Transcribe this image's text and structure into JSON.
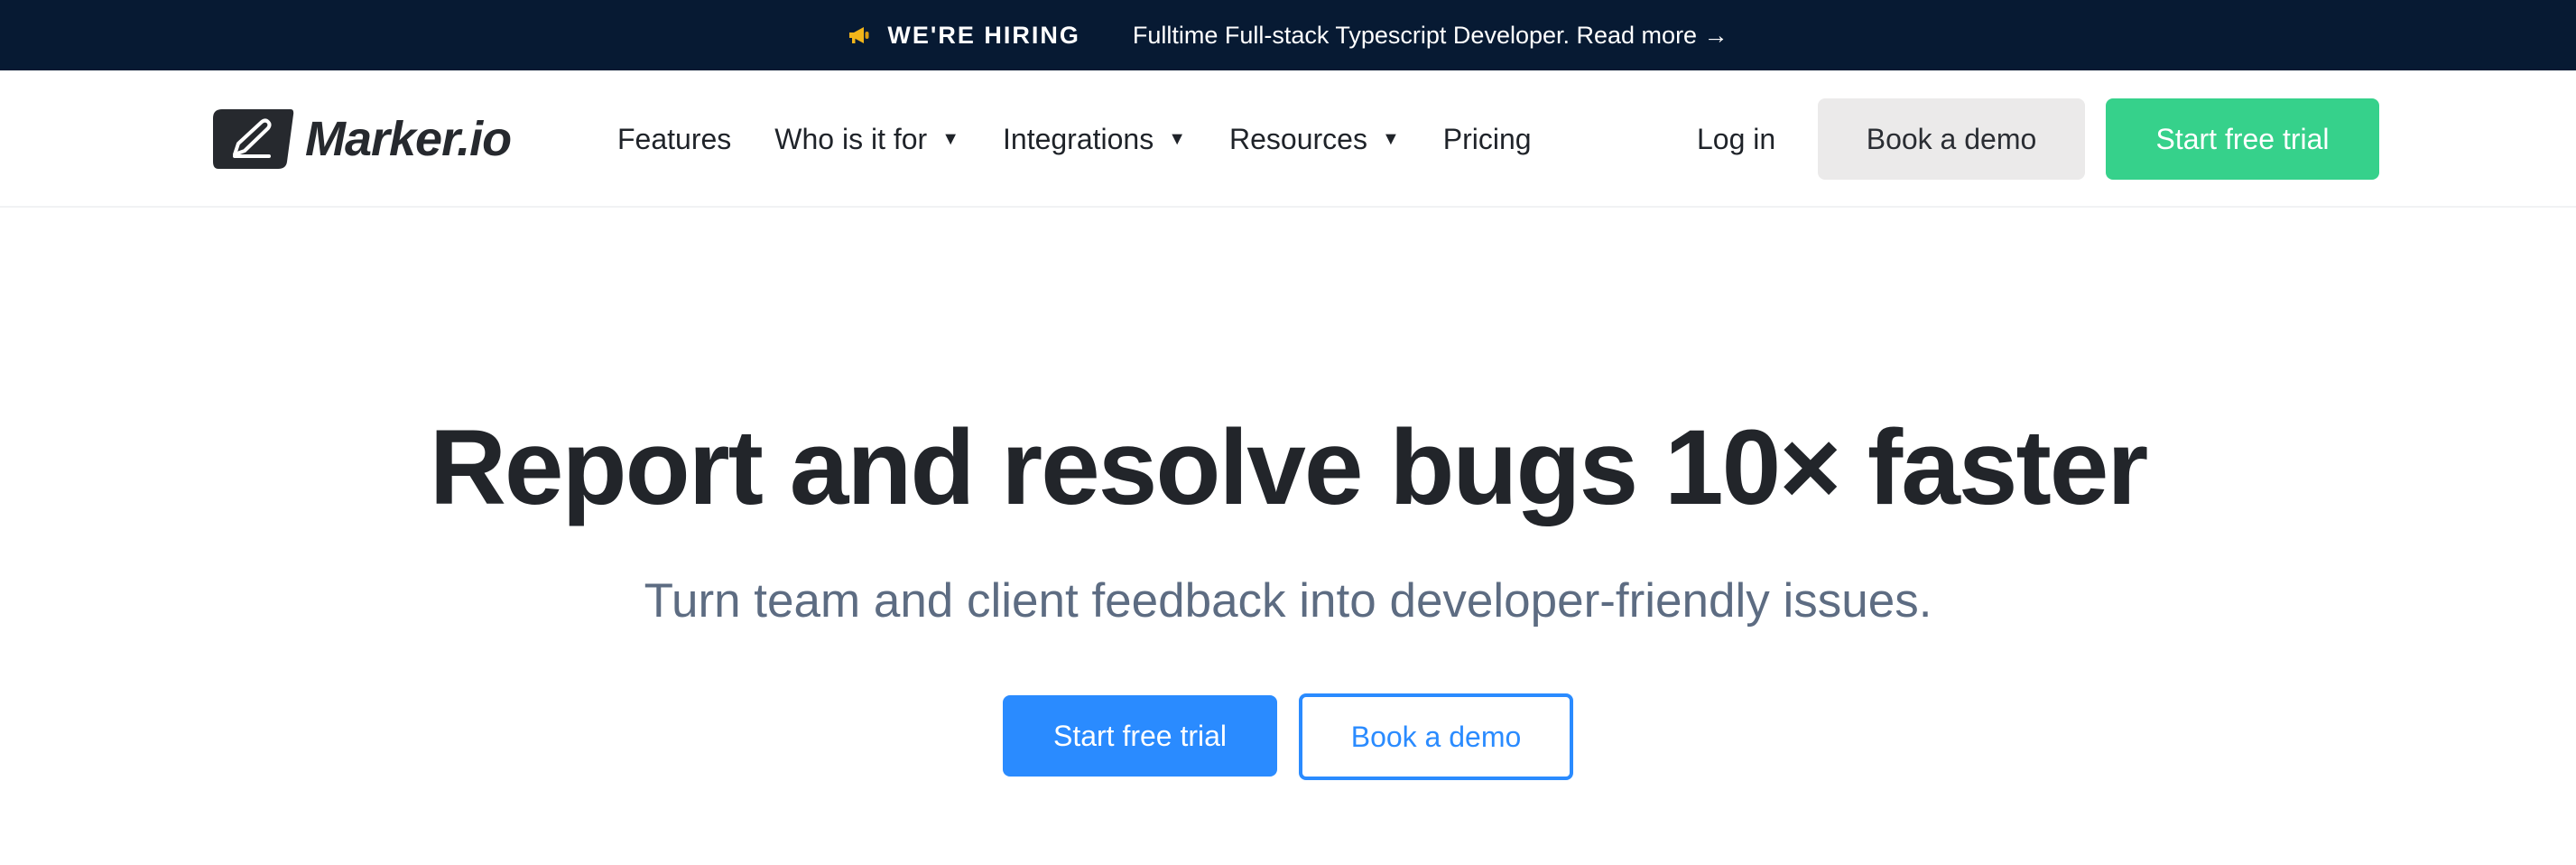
{
  "topbar": {
    "icon": "megaphone-icon",
    "hiring_label": "WE'RE HIRING",
    "announcement_link": "Fulltime Full-stack Typescript Developer. Read more →"
  },
  "nav": {
    "logo_text": "Marker.io",
    "items": [
      {
        "label": "Features",
        "has_dropdown": false
      },
      {
        "label": "Who is it for",
        "has_dropdown": true
      },
      {
        "label": "Integrations",
        "has_dropdown": true
      },
      {
        "label": "Resources",
        "has_dropdown": true
      },
      {
        "label": "Pricing",
        "has_dropdown": false
      }
    ],
    "caret_glyph": "▼",
    "login_label": "Log in",
    "demo_label": "Book a demo",
    "trial_label": "Start free trial"
  },
  "hero": {
    "title": "Report and resolve bugs 10× faster",
    "subtitle": "Turn team and client feedback into developer-friendly issues.",
    "primary_cta": "Start free trial",
    "secondary_cta": "Book a demo"
  },
  "colors": {
    "topbar_bg": "#071a33",
    "nav_trial_green": "#36d18b",
    "nav_demo_grey": "#ebeaea",
    "hero_blue": "#2a8bff",
    "subtitle_grey": "#5d6c82",
    "megaphone_yellow": "#f2b51a"
  }
}
